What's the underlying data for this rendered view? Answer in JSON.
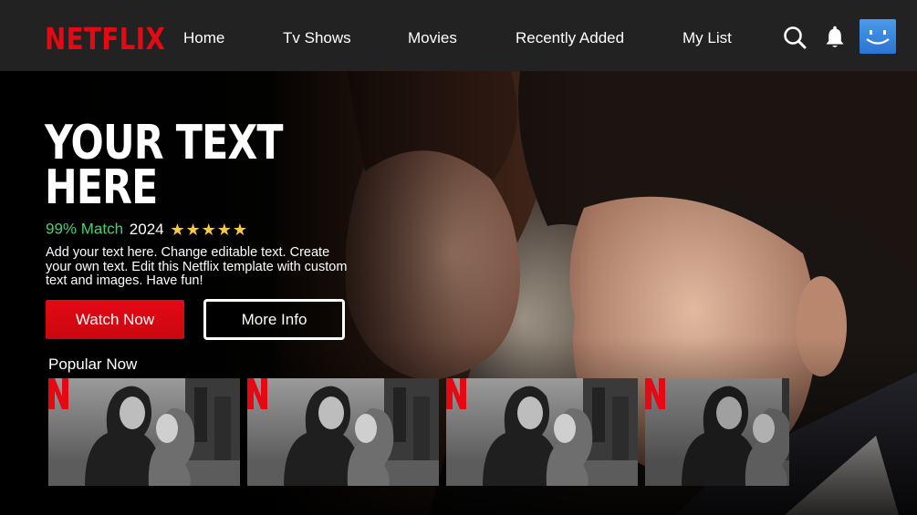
{
  "app": {
    "logo_text": "NETFLIX",
    "brand_color": "#e50914",
    "match_color": "#46d369",
    "star_color": "#f6c945"
  },
  "nav": {
    "items": [
      "Home",
      "Tv Shows",
      "Movies",
      "Recently Added",
      "My List"
    ],
    "icons": [
      "search-icon",
      "bell-icon",
      "avatar-smiley-icon"
    ]
  },
  "hero": {
    "title": "YOUR TEXT HERE",
    "match": "99% Match",
    "year": "2024",
    "rating_stars": 5,
    "stars_text": "★★★★★",
    "description": "Add your text here. Change editable text. Create your own text. Edit this Netflix template with custom text and images. Have fun!",
    "watch_label": "Watch Now",
    "info_label": "More Info"
  },
  "popular": {
    "title": "Popular Now",
    "thumbnails": [
      {
        "badge": "netflix-n-badge-icon"
      },
      {
        "badge": "netflix-n-badge-icon"
      },
      {
        "badge": "netflix-n-badge-icon"
      },
      {
        "badge": "netflix-n-badge-icon"
      }
    ]
  }
}
